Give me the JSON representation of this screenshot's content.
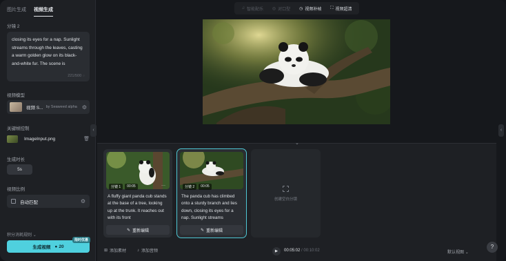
{
  "tabs": [
    {
      "label": "图片生成"
    },
    {
      "label": "视频生成"
    }
  ],
  "left": {
    "shot_label": "分镜 2",
    "prompt_text": "closing its eyes for a nap. Sunlight streams through the leaves, casting a warm golden glow on its black-and-white fur. The scene is",
    "prompt_count": "221/500",
    "model_label": "视频模型",
    "model_name": "视频 S...",
    "model_by": "by Seaweed alpha",
    "keyframe_label": "关键帧控制",
    "keyframe_file": "ImageInput.png",
    "duration_label": "生成时长",
    "duration_value": "5s",
    "ratio_label": "视频比例",
    "ratio_value": "自动匹配",
    "credits_rule": "积分消耗规则",
    "generate_label": "生成视频",
    "generate_cost": "20",
    "generate_badge": "限时优惠"
  },
  "toolbar": {
    "items": [
      {
        "label": "智能配乐",
        "enabled": false,
        "icon": "music-icon"
      },
      {
        "label": "对口型",
        "enabled": false,
        "icon": "lipsync-icon"
      },
      {
        "label": "视频补帧",
        "enabled": true,
        "icon": "frame-interp-icon"
      },
      {
        "label": "视频超清",
        "enabled": true,
        "icon": "upscale-icon"
      }
    ]
  },
  "clips": [
    {
      "shot": "分镜 1",
      "duration": "00:05",
      "text": "A fluffy giant panda cub stands at the base of a tree, looking up at the trunk. It reaches out with its front",
      "action": "重新编辑"
    },
    {
      "shot": "分镜 2",
      "duration": "00:05",
      "text": "The panda cub has climbed onto a sturdy branch and lies down, closing its eyes for a nap. Sunlight streams",
      "action": "重新编辑"
    }
  ],
  "add_clip_label": "创建空白分镜",
  "bottom": {
    "add_material": "添加素材",
    "add_audio": "添加音频",
    "time_current": "00:05:02",
    "time_total": "/ 00:10:02",
    "view_mode": "默认视图",
    "help": "?"
  }
}
